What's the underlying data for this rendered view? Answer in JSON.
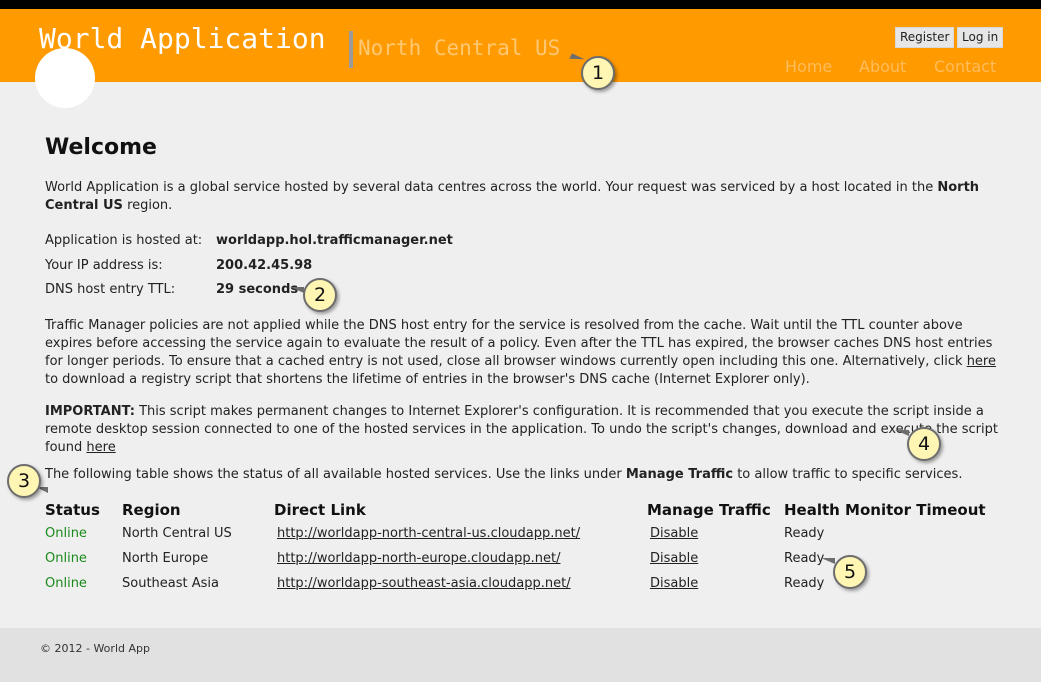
{
  "header": {
    "app_title": "World Application",
    "region_title": "North Central US",
    "register_label": "Register",
    "login_label": "Log in",
    "nav": {
      "home": "Home",
      "about": "About",
      "contact": "Contact"
    },
    "colors": {
      "bar": "#ff9a00",
      "region": "#ffc873"
    }
  },
  "main": {
    "heading": "Welcome",
    "intro_text": "World Application is a global service hosted by several data centres across the world. Your request was serviced by a host located in the",
    "intro_region": "North Central US",
    "intro_suffix": "region.",
    "info": {
      "hosted_label": "Application is hosted at:",
      "hosted_value": "worldapp.hol.trafficmanager.net",
      "ip_label": "Your IP address is:",
      "ip_value": "200.42.45.98",
      "ttl_label": "DNS host entry TTL:",
      "ttl_value": "29 seconds"
    },
    "policy_text": "Traffic Manager policies are not applied while the DNS host entry for the service is resolved from the cache. Wait until the TTL counter above expires before accessing the service again to evaluate the result of a policy. Even after the TTL has expired, the browser caches DNS host entries for longer periods. To ensure that a cached entry is not used, close all browser windows currently open including this one. Alternatively, click",
    "policy_link": "here",
    "policy_suffix": "to download a registry script that shortens the lifetime of entries in the browser's DNS cache (Internet Explorer only).",
    "important_label": "IMPORTANT:",
    "important_text": "This script makes permanent changes to Internet Explorer's configuration. It is recommended that you execute the script inside a remote desktop session connected to one of the hosted services in the application. To undo the script's changes, download and execute the script found",
    "important_link": "here",
    "table_intro": "The following table shows the status of all available hosted services. Use the links under",
    "table_intro_bold": "Manage Traffic",
    "table_intro_suffix": "to allow traffic to specific services."
  },
  "table": {
    "headers": [
      "Status",
      "Region",
      "Direct Link",
      "Manage Traffic",
      "Health Monitor Timeout"
    ],
    "rows": [
      {
        "status": "Online",
        "region": "North Central US",
        "link": "http://worldapp-north-central-us.cloudapp.net/",
        "manage": "Disable",
        "health": "Ready"
      },
      {
        "status": "Online",
        "region": "North Europe",
        "link": "http://worldapp-north-europe.cloudapp.net/",
        "manage": "Disable",
        "health": "Ready"
      },
      {
        "status": "Online",
        "region": "Southeast Asia",
        "link": "http://worldapp-southeast-asia.cloudapp.net/",
        "manage": "Disable",
        "health": "Ready"
      }
    ]
  },
  "footer": {
    "copyright": "© 2012 - World App"
  },
  "callouts": [
    "1",
    "2",
    "3",
    "4",
    "5"
  ]
}
